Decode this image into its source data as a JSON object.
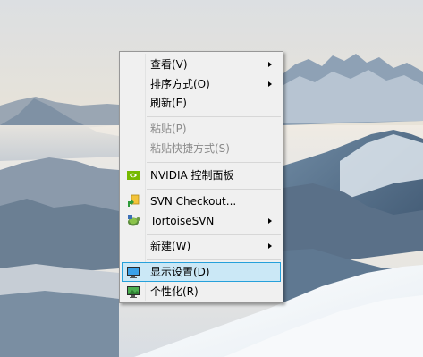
{
  "context_menu": {
    "items": {
      "view": "查看(V)",
      "sort": "排序方式(O)",
      "refresh": "刷新(E)",
      "paste": "粘贴(P)",
      "paste_shortcut": "粘贴快捷方式(S)",
      "nvidia": "NVIDIA 控制面板",
      "svn_checkout": "SVN Checkout...",
      "tortoisesvn": "TortoiseSVN",
      "new": "新建(W)",
      "display": "显示设置(D)",
      "personalize": "个性化(R)"
    },
    "highlighted_item": "display",
    "disabled_items": [
      "paste",
      "paste_shortcut"
    ],
    "icons": {
      "nvidia": "nvidia-icon",
      "svn_checkout": "svn-checkout-icon",
      "tortoisesvn": "tortoisesvn-icon",
      "display": "display-settings-icon",
      "personalize": "personalize-icon"
    }
  },
  "colors": {
    "menu_bg": "#f0f0f0",
    "highlight_bg": "#cbe8f6",
    "highlight_border": "#26a0da",
    "disabled_text": "#8a8a8a"
  }
}
